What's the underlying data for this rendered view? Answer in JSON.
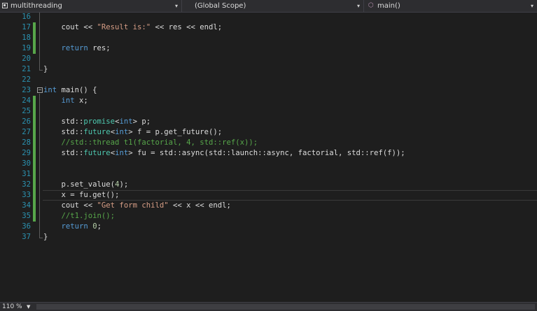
{
  "navbar": {
    "project": "multithreading",
    "scope": "(Global Scope)",
    "member": "main()"
  },
  "status": {
    "zoom": "110 %"
  },
  "lines": [
    {
      "n": "16",
      "changed": false,
      "tokens": []
    },
    {
      "n": "17",
      "changed": true,
      "tokens": [
        {
          "t": "    cout << "
        },
        {
          "t": "\"Result is:\"",
          "c": "s"
        },
        {
          "t": " << res << endl;"
        }
      ]
    },
    {
      "n": "18",
      "changed": true,
      "tokens": []
    },
    {
      "n": "19",
      "changed": true,
      "tokens": [
        {
          "t": "    "
        },
        {
          "t": "return",
          "c": "k"
        },
        {
          "t": " res;"
        }
      ]
    },
    {
      "n": "20",
      "changed": false,
      "tokens": []
    },
    {
      "n": "21",
      "changed": false,
      "tokens": [
        {
          "t": "}"
        }
      ]
    },
    {
      "n": "22",
      "changed": false,
      "tokens": []
    },
    {
      "n": "23",
      "changed": false,
      "tokens": [
        {
          "t": "int",
          "c": "k"
        },
        {
          "t": " main() {"
        }
      ]
    },
    {
      "n": "24",
      "changed": true,
      "tokens": [
        {
          "t": "    "
        },
        {
          "t": "int",
          "c": "k"
        },
        {
          "t": " x;"
        }
      ]
    },
    {
      "n": "25",
      "changed": true,
      "tokens": []
    },
    {
      "n": "26",
      "changed": true,
      "tokens": [
        {
          "t": "    std::"
        },
        {
          "t": "promise",
          "c": "t"
        },
        {
          "t": "<"
        },
        {
          "t": "int",
          "c": "k"
        },
        {
          "t": "> p;"
        }
      ]
    },
    {
      "n": "27",
      "changed": true,
      "tokens": [
        {
          "t": "    std::"
        },
        {
          "t": "future",
          "c": "t"
        },
        {
          "t": "<"
        },
        {
          "t": "int",
          "c": "k"
        },
        {
          "t": "> f = p.get_future();"
        }
      ]
    },
    {
      "n": "28",
      "changed": true,
      "tokens": [
        {
          "t": "    "
        },
        {
          "t": "//std::thread t1(factorial, 4, std::ref(x));",
          "c": "c"
        }
      ]
    },
    {
      "n": "29",
      "changed": true,
      "tokens": [
        {
          "t": "    std::"
        },
        {
          "t": "future",
          "c": "t"
        },
        {
          "t": "<"
        },
        {
          "t": "int",
          "c": "k"
        },
        {
          "t": "> fu = std::async(std::launch::async, factorial, std::ref(f));"
        }
      ]
    },
    {
      "n": "30",
      "changed": true,
      "tokens": []
    },
    {
      "n": "31",
      "changed": true,
      "tokens": []
    },
    {
      "n": "32",
      "changed": true,
      "tokens": [
        {
          "t": "    p.set_value("
        },
        {
          "t": "4",
          "c": "n"
        },
        {
          "t": ");"
        }
      ]
    },
    {
      "n": "33",
      "changed": true,
      "current": true,
      "tokens": [
        {
          "t": "    x = fu.get();"
        }
      ]
    },
    {
      "n": "34",
      "changed": true,
      "tokens": [
        {
          "t": "    cout << "
        },
        {
          "t": "\"Get form child\"",
          "c": "s"
        },
        {
          "t": " << x << endl;"
        }
      ]
    },
    {
      "n": "35",
      "changed": true,
      "tokens": [
        {
          "t": "    "
        },
        {
          "t": "//t1.join();",
          "c": "c"
        }
      ]
    },
    {
      "n": "36",
      "changed": false,
      "tokens": [
        {
          "t": "    "
        },
        {
          "t": "return",
          "c": "k"
        },
        {
          "t": " "
        },
        {
          "t": "0",
          "c": "n"
        },
        {
          "t": ";"
        }
      ]
    },
    {
      "n": "37",
      "changed": false,
      "tokens": [
        {
          "t": "}"
        }
      ]
    }
  ],
  "icons": {
    "project": "project-icon",
    "member": "method-icon",
    "fold": "collapse-icon",
    "dropdown": "chevron-down-icon"
  }
}
